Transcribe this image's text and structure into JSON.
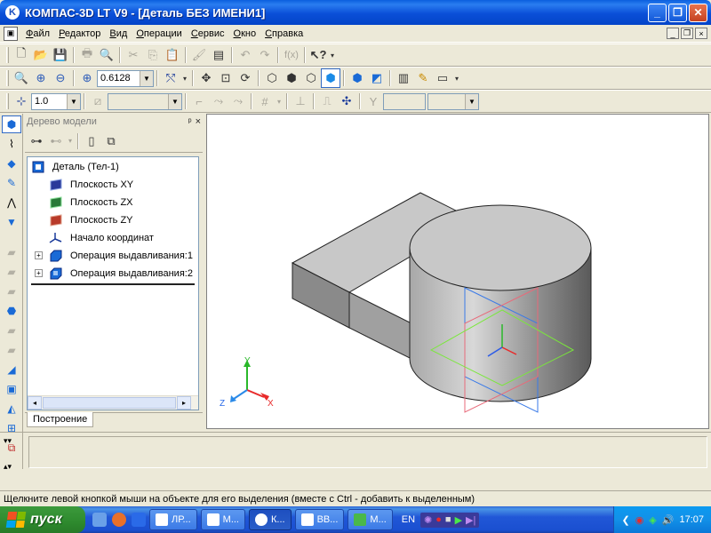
{
  "window": {
    "title": "КОМПАС-3D LT V9 - [Деталь БЕЗ ИМЕНИ1]",
    "app_icon": "kompas-logo-icon",
    "minimize": "_",
    "maximize": "❐",
    "close": "✕"
  },
  "menu": {
    "items": [
      "Файл",
      "Редактор",
      "Вид",
      "Операции",
      "Сервис",
      "Окно",
      "Справка"
    ],
    "mdi": [
      "_",
      "❐",
      "×"
    ]
  },
  "toolbar_view": {
    "zoom_value": "0.6128"
  },
  "toolbar_props": {
    "step_value": "1.0"
  },
  "tree": {
    "header": "Дерево модели",
    "pin": "ᵖ",
    "close": "×",
    "items": [
      {
        "label": "Деталь (Тел-1)",
        "icon": "part-icon"
      },
      {
        "label": "Плоскость XY",
        "icon": "plane-xy-icon"
      },
      {
        "label": "Плоскость ZX",
        "icon": "plane-zx-icon"
      },
      {
        "label": "Плоскость ZY",
        "icon": "plane-zy-icon"
      },
      {
        "label": "Начало координат",
        "icon": "origin-icon"
      },
      {
        "label": "Операция выдавливания:1",
        "icon": "extrude-icon"
      },
      {
        "label": "Операция выдавливания:2",
        "icon": "extrude-icon"
      }
    ],
    "tab": "Построение"
  },
  "axes": {
    "x": "X",
    "y": "Y",
    "z": "Z"
  },
  "statusbar": {
    "message": "Щелкните левой кнопкой мыши на объекте для его выделения (вместе с Ctrl - добавить к выделенным)"
  },
  "taskbar": {
    "start": "пуск",
    "tasks": [
      {
        "label": "ЛР..."
      },
      {
        "label": "М..."
      },
      {
        "label": "К..."
      },
      {
        "label": "ВВ..."
      },
      {
        "label": "М..."
      }
    ],
    "lang": "EN",
    "clock": "17:07"
  },
  "colors": {
    "titlebar": "#0a4fd8",
    "accent": "#316ac5",
    "model_face": "#c8c8c8"
  }
}
